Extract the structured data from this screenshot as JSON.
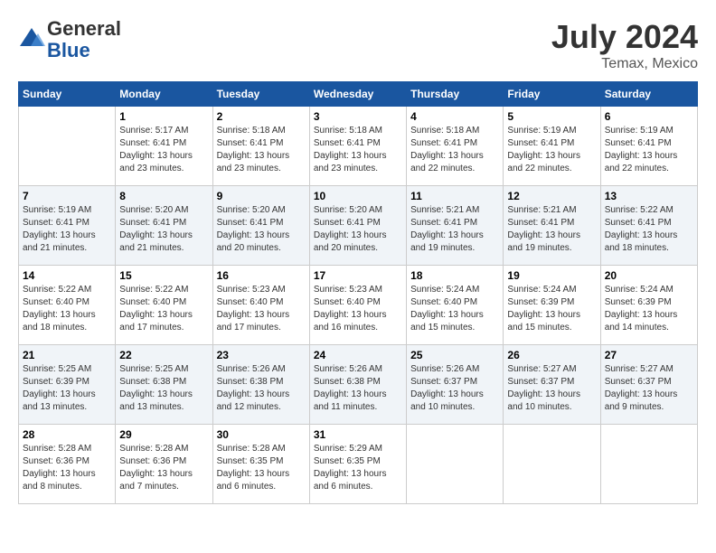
{
  "header": {
    "logo_line1": "General",
    "logo_line2": "Blue",
    "month": "July 2024",
    "location": "Temax, Mexico"
  },
  "days_of_week": [
    "Sunday",
    "Monday",
    "Tuesday",
    "Wednesday",
    "Thursday",
    "Friday",
    "Saturday"
  ],
  "weeks": [
    [
      {
        "day": "",
        "info": ""
      },
      {
        "day": "1",
        "info": "Sunrise: 5:17 AM\nSunset: 6:41 PM\nDaylight: 13 hours\nand 23 minutes."
      },
      {
        "day": "2",
        "info": "Sunrise: 5:18 AM\nSunset: 6:41 PM\nDaylight: 13 hours\nand 23 minutes."
      },
      {
        "day": "3",
        "info": "Sunrise: 5:18 AM\nSunset: 6:41 PM\nDaylight: 13 hours\nand 23 minutes."
      },
      {
        "day": "4",
        "info": "Sunrise: 5:18 AM\nSunset: 6:41 PM\nDaylight: 13 hours\nand 22 minutes."
      },
      {
        "day": "5",
        "info": "Sunrise: 5:19 AM\nSunset: 6:41 PM\nDaylight: 13 hours\nand 22 minutes."
      },
      {
        "day": "6",
        "info": "Sunrise: 5:19 AM\nSunset: 6:41 PM\nDaylight: 13 hours\nand 22 minutes."
      }
    ],
    [
      {
        "day": "7",
        "info": "Sunrise: 5:19 AM\nSunset: 6:41 PM\nDaylight: 13 hours\nand 21 minutes."
      },
      {
        "day": "8",
        "info": "Sunrise: 5:20 AM\nSunset: 6:41 PM\nDaylight: 13 hours\nand 21 minutes."
      },
      {
        "day": "9",
        "info": "Sunrise: 5:20 AM\nSunset: 6:41 PM\nDaylight: 13 hours\nand 20 minutes."
      },
      {
        "day": "10",
        "info": "Sunrise: 5:20 AM\nSunset: 6:41 PM\nDaylight: 13 hours\nand 20 minutes."
      },
      {
        "day": "11",
        "info": "Sunrise: 5:21 AM\nSunset: 6:41 PM\nDaylight: 13 hours\nand 19 minutes."
      },
      {
        "day": "12",
        "info": "Sunrise: 5:21 AM\nSunset: 6:41 PM\nDaylight: 13 hours\nand 19 minutes."
      },
      {
        "day": "13",
        "info": "Sunrise: 5:22 AM\nSunset: 6:41 PM\nDaylight: 13 hours\nand 18 minutes."
      }
    ],
    [
      {
        "day": "14",
        "info": "Sunrise: 5:22 AM\nSunset: 6:40 PM\nDaylight: 13 hours\nand 18 minutes."
      },
      {
        "day": "15",
        "info": "Sunrise: 5:22 AM\nSunset: 6:40 PM\nDaylight: 13 hours\nand 17 minutes."
      },
      {
        "day": "16",
        "info": "Sunrise: 5:23 AM\nSunset: 6:40 PM\nDaylight: 13 hours\nand 17 minutes."
      },
      {
        "day": "17",
        "info": "Sunrise: 5:23 AM\nSunset: 6:40 PM\nDaylight: 13 hours\nand 16 minutes."
      },
      {
        "day": "18",
        "info": "Sunrise: 5:24 AM\nSunset: 6:40 PM\nDaylight: 13 hours\nand 15 minutes."
      },
      {
        "day": "19",
        "info": "Sunrise: 5:24 AM\nSunset: 6:39 PM\nDaylight: 13 hours\nand 15 minutes."
      },
      {
        "day": "20",
        "info": "Sunrise: 5:24 AM\nSunset: 6:39 PM\nDaylight: 13 hours\nand 14 minutes."
      }
    ],
    [
      {
        "day": "21",
        "info": "Sunrise: 5:25 AM\nSunset: 6:39 PM\nDaylight: 13 hours\nand 13 minutes."
      },
      {
        "day": "22",
        "info": "Sunrise: 5:25 AM\nSunset: 6:38 PM\nDaylight: 13 hours\nand 13 minutes."
      },
      {
        "day": "23",
        "info": "Sunrise: 5:26 AM\nSunset: 6:38 PM\nDaylight: 13 hours\nand 12 minutes."
      },
      {
        "day": "24",
        "info": "Sunrise: 5:26 AM\nSunset: 6:38 PM\nDaylight: 13 hours\nand 11 minutes."
      },
      {
        "day": "25",
        "info": "Sunrise: 5:26 AM\nSunset: 6:37 PM\nDaylight: 13 hours\nand 10 minutes."
      },
      {
        "day": "26",
        "info": "Sunrise: 5:27 AM\nSunset: 6:37 PM\nDaylight: 13 hours\nand 10 minutes."
      },
      {
        "day": "27",
        "info": "Sunrise: 5:27 AM\nSunset: 6:37 PM\nDaylight: 13 hours\nand 9 minutes."
      }
    ],
    [
      {
        "day": "28",
        "info": "Sunrise: 5:28 AM\nSunset: 6:36 PM\nDaylight: 13 hours\nand 8 minutes."
      },
      {
        "day": "29",
        "info": "Sunrise: 5:28 AM\nSunset: 6:36 PM\nDaylight: 13 hours\nand 7 minutes."
      },
      {
        "day": "30",
        "info": "Sunrise: 5:28 AM\nSunset: 6:35 PM\nDaylight: 13 hours\nand 6 minutes."
      },
      {
        "day": "31",
        "info": "Sunrise: 5:29 AM\nSunset: 6:35 PM\nDaylight: 13 hours\nand 6 minutes."
      },
      {
        "day": "",
        "info": ""
      },
      {
        "day": "",
        "info": ""
      },
      {
        "day": "",
        "info": ""
      }
    ]
  ]
}
